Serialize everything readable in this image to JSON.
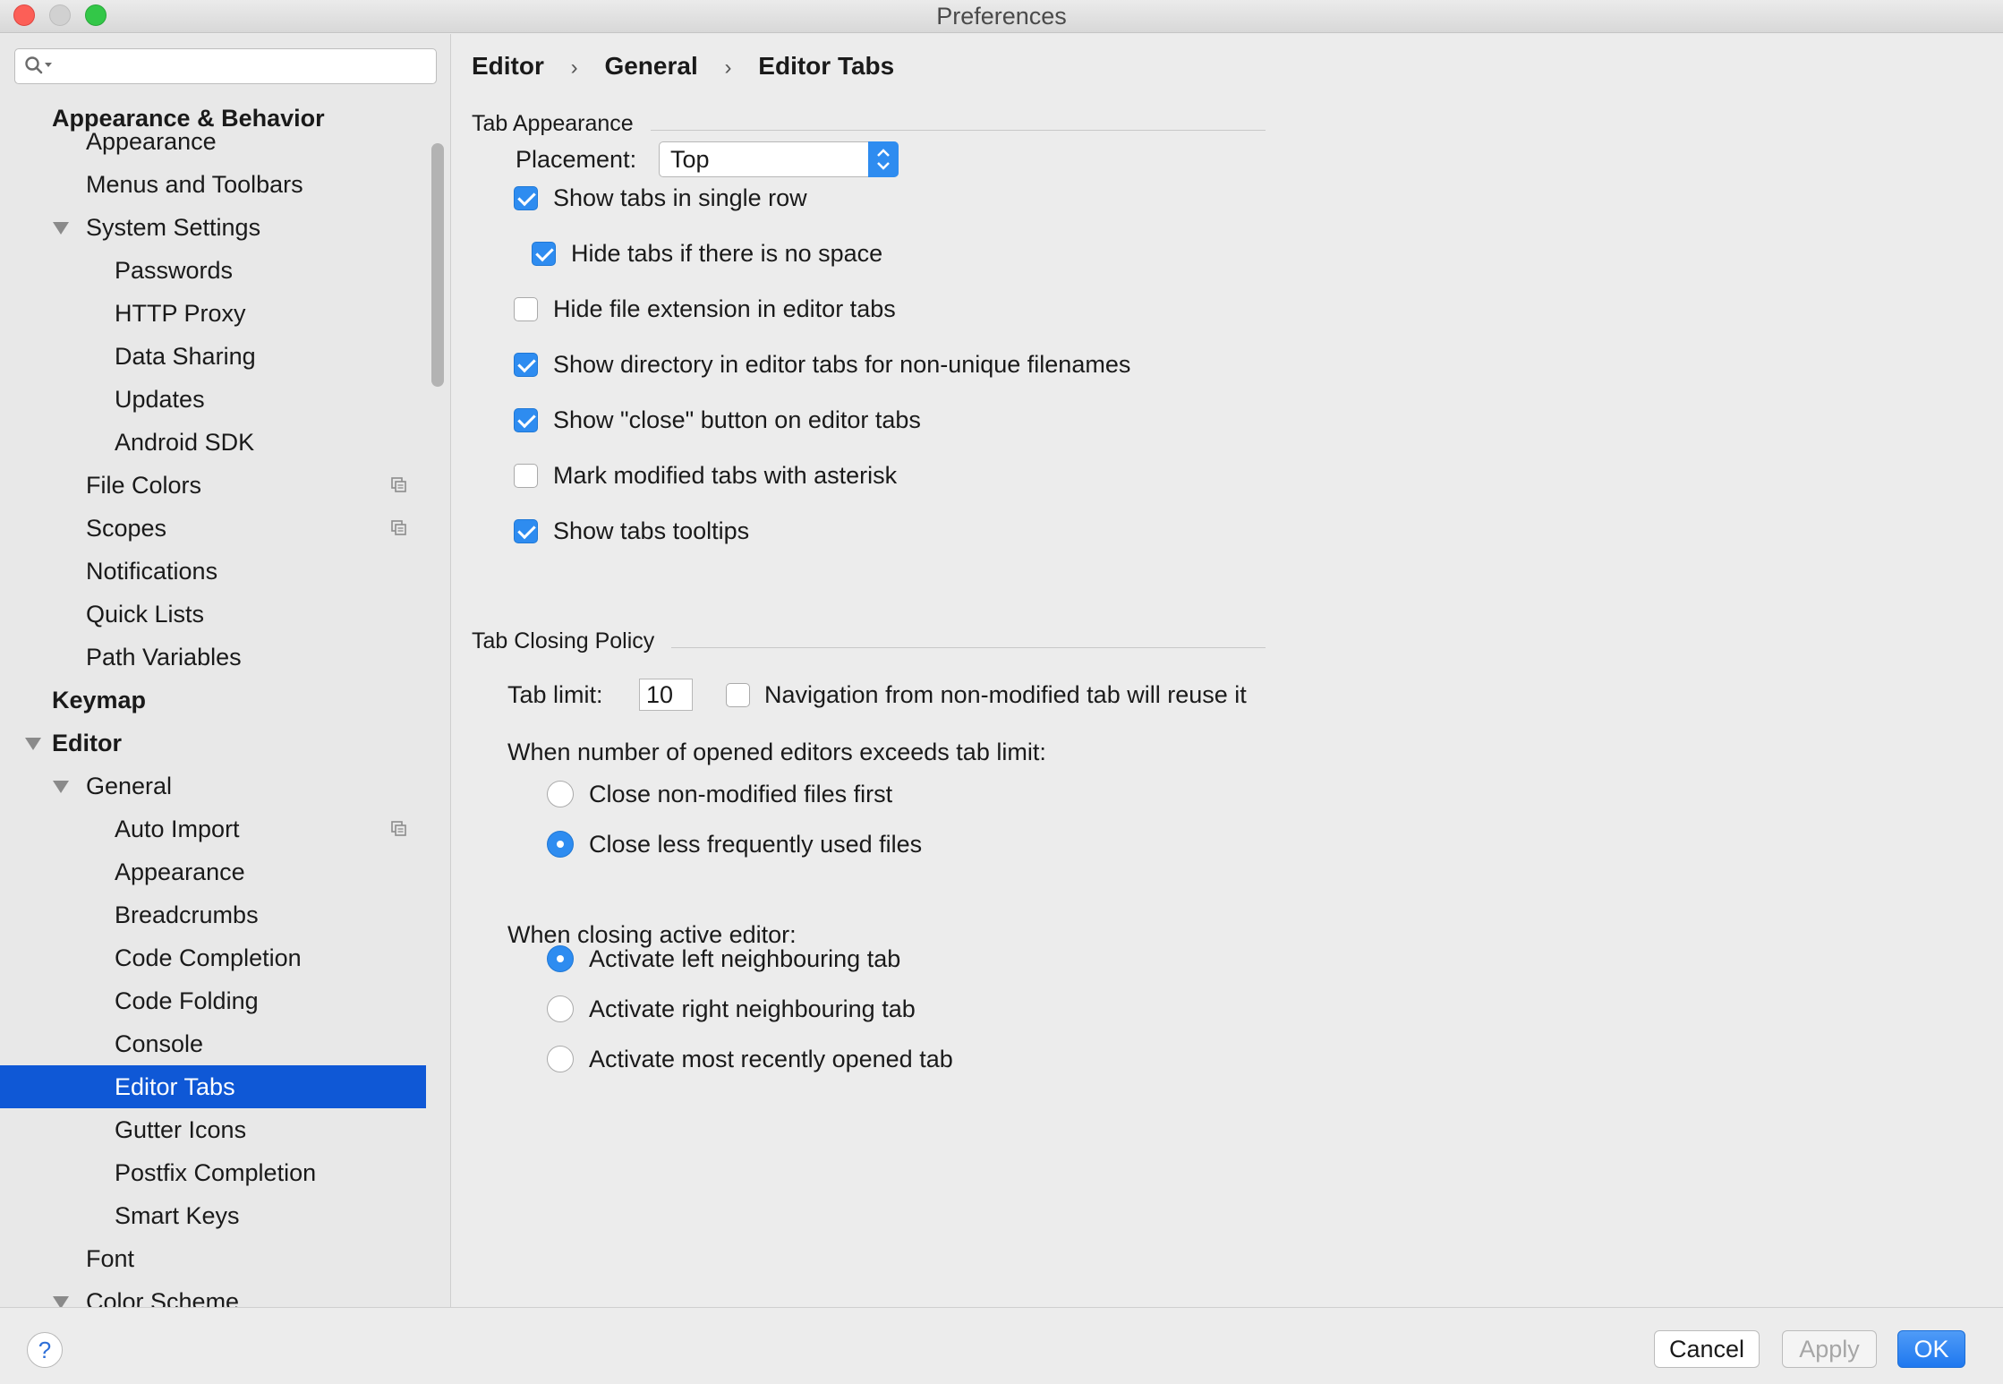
{
  "window": {
    "title": "Preferences"
  },
  "search": {
    "placeholder": ""
  },
  "sidebar": {
    "items": [
      {
        "label": "Appearance & Behavior",
        "level": 0,
        "bold": true,
        "expanded": true
      },
      {
        "label": "Appearance",
        "level": 1
      },
      {
        "label": "Menus and Toolbars",
        "level": 1
      },
      {
        "label": "System Settings",
        "level": 1,
        "expanded": true
      },
      {
        "label": "Passwords",
        "level": 2
      },
      {
        "label": "HTTP Proxy",
        "level": 2
      },
      {
        "label": "Data Sharing",
        "level": 2
      },
      {
        "label": "Updates",
        "level": 2
      },
      {
        "label": "Android SDK",
        "level": 2
      },
      {
        "label": "File Colors",
        "level": 1,
        "project_icon": true
      },
      {
        "label": "Scopes",
        "level": 1,
        "project_icon": true
      },
      {
        "label": "Notifications",
        "level": 1
      },
      {
        "label": "Quick Lists",
        "level": 1
      },
      {
        "label": "Path Variables",
        "level": 1
      },
      {
        "label": "Keymap",
        "level": 0,
        "bold": true
      },
      {
        "label": "Editor",
        "level": 0,
        "bold": true,
        "expanded": true
      },
      {
        "label": "General",
        "level": 1,
        "expanded": true
      },
      {
        "label": "Auto Import",
        "level": 2,
        "project_icon": true
      },
      {
        "label": "Appearance",
        "level": 2
      },
      {
        "label": "Breadcrumbs",
        "level": 2
      },
      {
        "label": "Code Completion",
        "level": 2
      },
      {
        "label": "Code Folding",
        "level": 2
      },
      {
        "label": "Console",
        "level": 2
      },
      {
        "label": "Editor Tabs",
        "level": 2,
        "selected": true
      },
      {
        "label": "Gutter Icons",
        "level": 2
      },
      {
        "label": "Postfix Completion",
        "level": 2
      },
      {
        "label": "Smart Keys",
        "level": 2
      },
      {
        "label": "Font",
        "level": 1
      },
      {
        "label": "Color Scheme",
        "level": 1,
        "expanded": true
      }
    ]
  },
  "breadcrumb": [
    "Editor",
    "General",
    "Editor Tabs"
  ],
  "tab_appearance": {
    "title": "Tab Appearance",
    "placement_label": "Placement:",
    "placement_value": "Top",
    "options": [
      {
        "label": "Show tabs in single row",
        "checked": true
      },
      {
        "label": "Hide tabs if there is no space",
        "checked": true
      },
      {
        "label": "Hide file extension in editor tabs",
        "checked": false
      },
      {
        "label": "Show directory in editor tabs for non-unique filenames",
        "checked": true
      },
      {
        "label": "Show \"close\" button on editor tabs",
        "checked": true
      },
      {
        "label": "Mark modified tabs with asterisk",
        "checked": false
      },
      {
        "label": "Show tabs tooltips",
        "checked": true
      }
    ]
  },
  "tab_closing": {
    "title": "Tab Closing Policy",
    "tab_limit_label": "Tab limit:",
    "tab_limit_value": "10",
    "reuse_label": "Navigation from non-modified tab will reuse it",
    "reuse_checked": false,
    "exceeds_label": "When number of opened editors exceeds tab limit:",
    "exceeds_options": [
      {
        "label": "Close non-modified files first",
        "selected": false
      },
      {
        "label": "Close less frequently used files",
        "selected": true
      }
    ],
    "closing_label": "When closing active editor:",
    "closing_options": [
      {
        "label": "Activate left neighbouring tab",
        "selected": true
      },
      {
        "label": "Activate right neighbouring tab",
        "selected": false
      },
      {
        "label": "Activate most recently opened tab",
        "selected": false
      }
    ]
  },
  "footer": {
    "help": "?",
    "cancel": "Cancel",
    "apply": "Apply",
    "ok": "OK"
  },
  "colors": {
    "accent": "#2e8cf0",
    "selection": "#0f58d6"
  }
}
